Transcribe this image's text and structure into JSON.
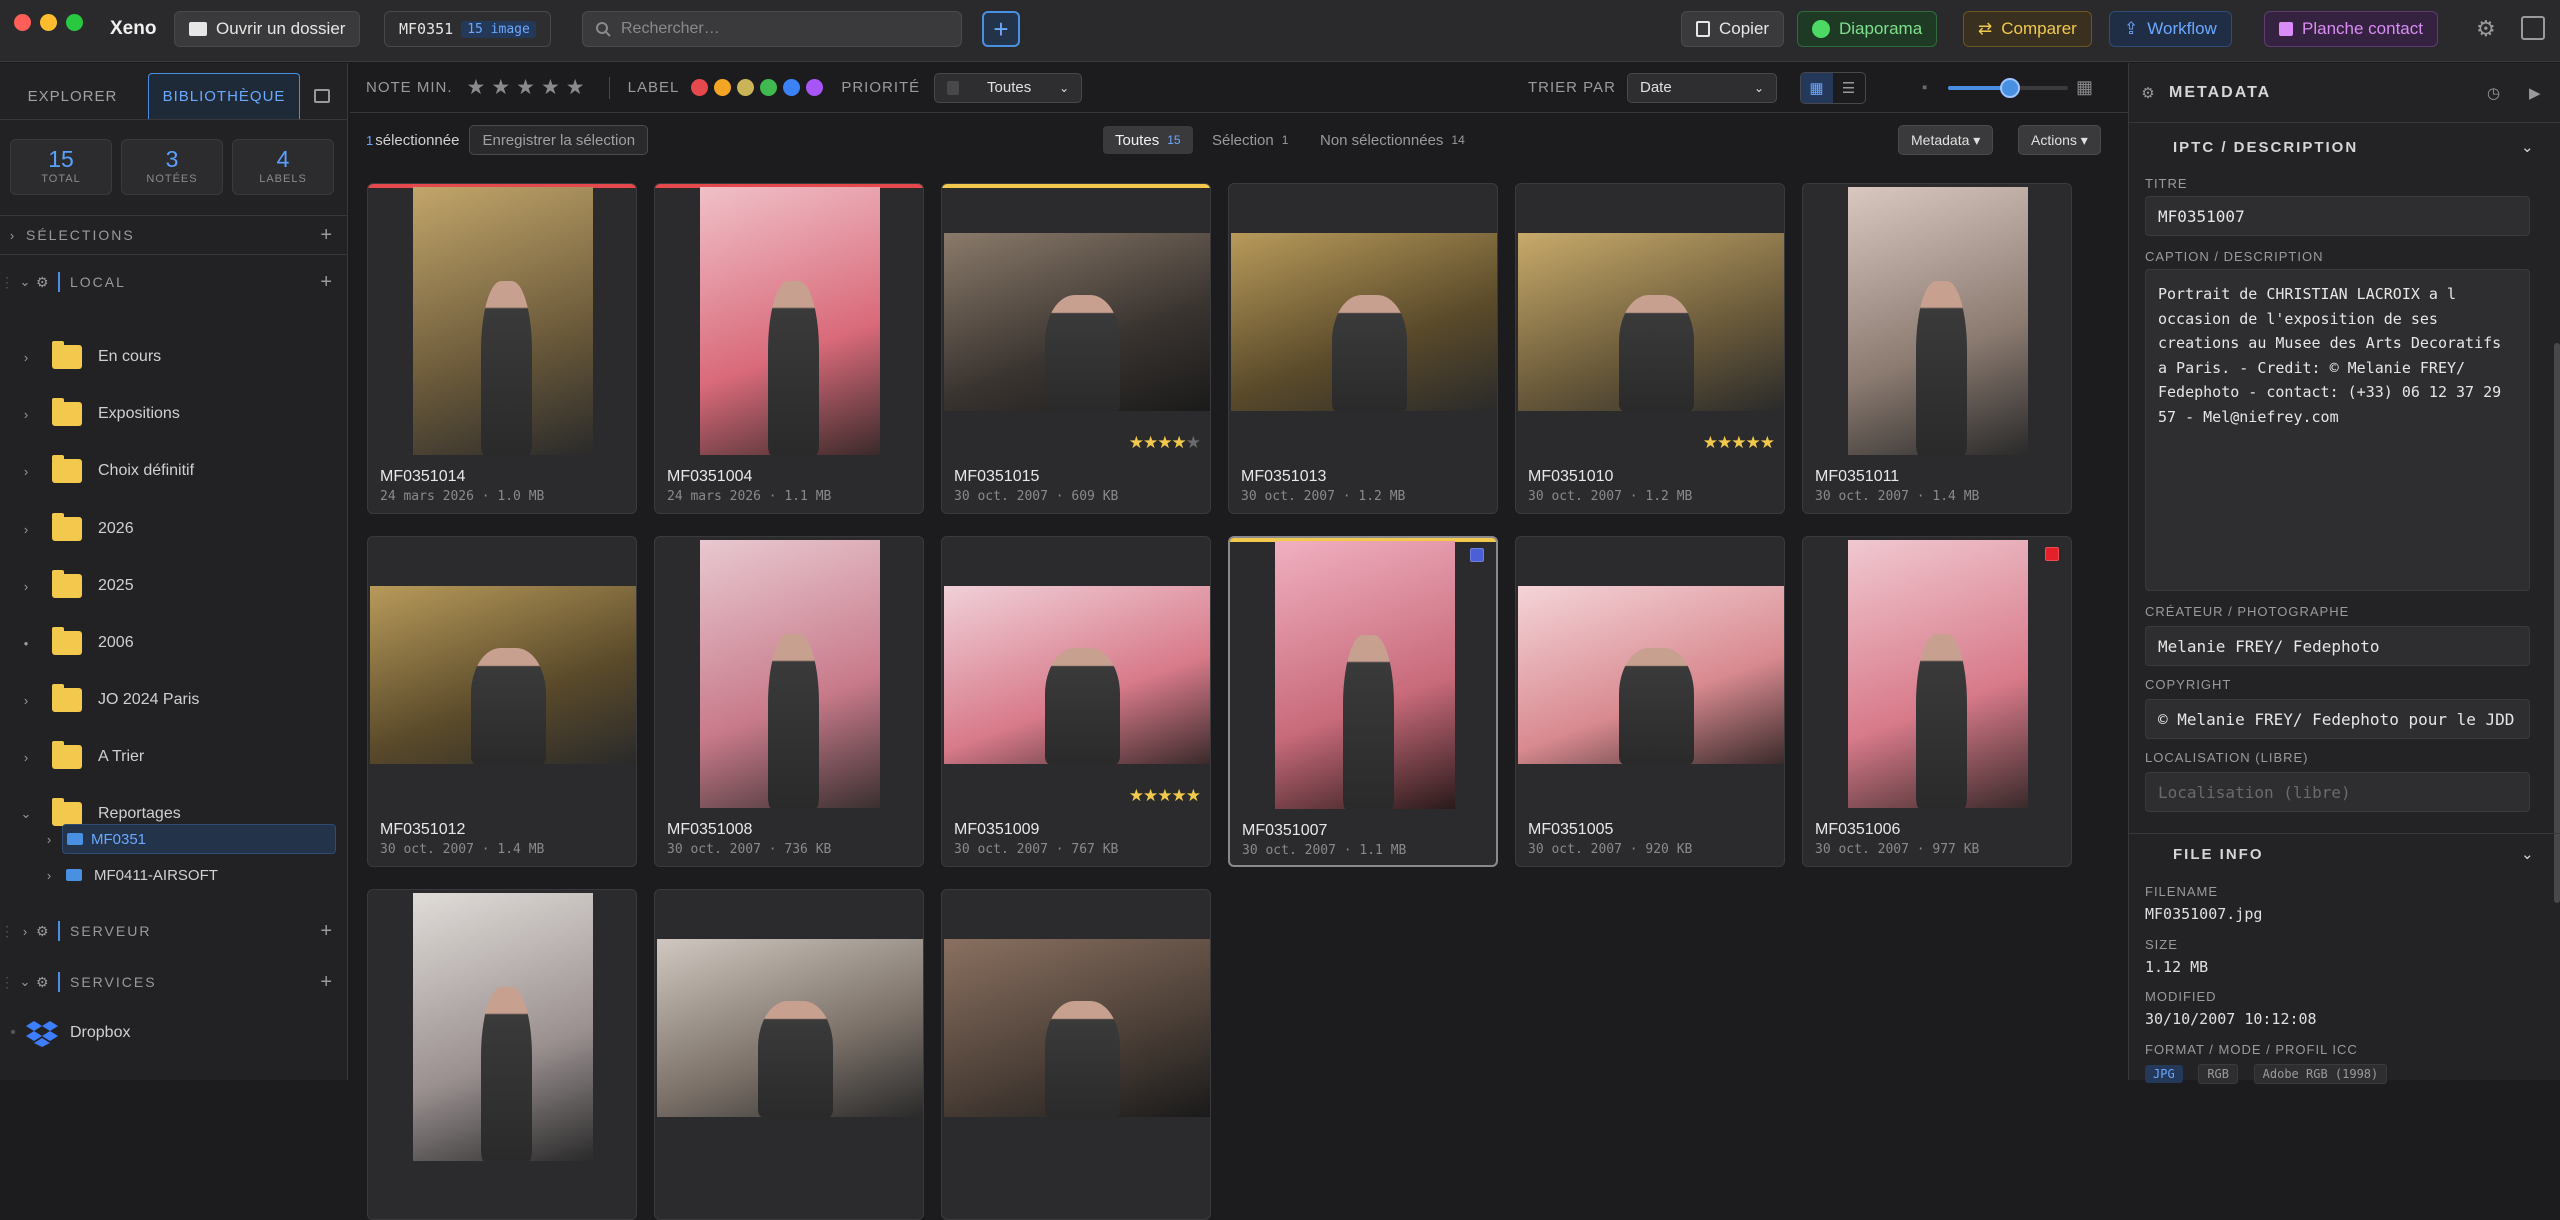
{
  "app": {
    "name": "Xeno"
  },
  "toolbar": {
    "open_folder": "Ouvrir un dossier",
    "folder_code": "MF0351",
    "image_count": "15 image",
    "search_placeholder": "Rechercher…",
    "copy": "Copier",
    "slideshow": "Diaporama",
    "compare": "Comparer",
    "workflow": "Workflow",
    "contact_sheet": "Planche contact"
  },
  "sidebar": {
    "tab_explorer": "EXPLORER",
    "tab_library": "BIBLIOTHÈQUE",
    "stats": [
      {
        "value": "15",
        "label": "TOTAL"
      },
      {
        "value": "3",
        "label": "NOTÉES"
      },
      {
        "value": "4",
        "label": "LABELS"
      }
    ],
    "selections": "SÉLECTIONS",
    "local": "LOCAL",
    "folders": [
      {
        "label": "En cours"
      },
      {
        "label": "Expositions"
      },
      {
        "label": "Choix définitif"
      },
      {
        "label": "2026"
      },
      {
        "label": "2025"
      },
      {
        "label": "2006"
      },
      {
        "label": "JO 2024 Paris"
      },
      {
        "label": "A Trier"
      },
      {
        "label": "Reportages"
      }
    ],
    "subfolders": [
      {
        "label": "MF0351"
      },
      {
        "label": "MF0411-AIRSOFT"
      }
    ],
    "server": "SERVEUR",
    "services": "SERVICES",
    "dropbox": "Dropbox"
  },
  "filters": {
    "min_rating": "NOTE MIN.",
    "label": "LABEL",
    "label_colors": [
      "#e5484d",
      "#f5a524",
      "#c9b458",
      "#3fb950",
      "#3b82f6",
      "#a855f7"
    ],
    "priority": "PRIORITÉ",
    "priority_value": "Toutes",
    "sort_by": "TRIER PAR",
    "sort_value": "Date"
  },
  "selection": {
    "count": "1",
    "selected_label": "sélectionnée",
    "save": "Enregistrer la sélection",
    "all": "Toutes",
    "all_count": "15",
    "sel": "Sélection",
    "sel_count": "1",
    "unsel": "Non sélectionnées",
    "unsel_count": "14",
    "metadata_btn": "Metadata ▾",
    "actions_btn": "Actions ▾"
  },
  "photos": [
    {
      "name": "MF0351014",
      "date": "24 mars 2026",
      "size": "1.0 MB",
      "stars": 0,
      "flag": "",
      "top": "#e5484d"
    },
    {
      "name": "MF0351004",
      "date": "24 mars 2026",
      "size": "1.1 MB",
      "stars": 0,
      "flag": "",
      "top": "#e5484d"
    },
    {
      "name": "MF0351015",
      "date": "30 oct. 2007",
      "size": "609 KB",
      "stars": 4,
      "flag": "",
      "top": "#f2c94c"
    },
    {
      "name": "MF0351013",
      "date": "30 oct. 2007",
      "size": "1.2 MB",
      "stars": 0,
      "flag": "",
      "top": ""
    },
    {
      "name": "MF0351010",
      "date": "30 oct. 2007",
      "size": "1.2 MB",
      "stars": 5,
      "flag": "",
      "top": ""
    },
    {
      "name": "MF0351011",
      "date": "30 oct. 2007",
      "size": "1.4 MB",
      "stars": 0,
      "flag": "",
      "top": ""
    },
    {
      "name": "MF0351012",
      "date": "30 oct. 2007",
      "size": "1.4 MB",
      "stars": 0,
      "flag": "",
      "top": ""
    },
    {
      "name": "MF0351008",
      "date": "30 oct. 2007",
      "size": "736 KB",
      "stars": 0,
      "flag": "",
      "top": ""
    },
    {
      "name": "MF0351009",
      "date": "30 oct. 2007",
      "size": "767 KB",
      "stars": 5,
      "flag": "",
      "top": ""
    },
    {
      "name": "MF0351007",
      "date": "30 oct. 2007",
      "size": "1.1 MB",
      "stars": 0,
      "flag": "#4b5fd6",
      "top": "#f2c94c"
    },
    {
      "name": "MF0351005",
      "date": "30 oct. 2007",
      "size": "920 KB",
      "stars": 0,
      "flag": "",
      "top": ""
    },
    {
      "name": "MF0351006",
      "date": "30 oct. 2007",
      "size": "977 KB",
      "stars": 0,
      "flag": "#e5202a",
      "top": ""
    },
    {
      "name": "",
      "date": "",
      "size": "",
      "stars": 0,
      "flag": "",
      "top": ""
    },
    {
      "name": "",
      "date": "",
      "size": "",
      "stars": 0,
      "flag": "",
      "top": ""
    },
    {
      "name": "",
      "date": "",
      "size": "",
      "stars": 0,
      "flag": "",
      "top": ""
    }
  ],
  "panel": {
    "title": "METADATA",
    "iptc": "IPTC / DESCRIPTION",
    "title_label": "TITRE",
    "title_value": "MF0351007",
    "caption_label": "CAPTION / DESCRIPTION",
    "caption_value": "Portrait de CHRISTIAN LACROIX a l occasion de l'exposition de ses creations au Musee des Arts Decoratifs a Paris. - Credit: © Melanie FREY/ Fedephoto - contact: (+33) 06 12 37 29 57 - Mel@niefrey.com",
    "creator_label": "CRÉATEUR / PHOTOGRAPHE",
    "creator_value": "Melanie FREY/ Fedephoto",
    "copyright_label": "COPYRIGHT",
    "copyright_value": "© Melanie FREY/ Fedephoto pour le JDD",
    "location_label": "LOCALISATION (LIBRE)",
    "location_placeholder": "Localisation (libre)",
    "file_info": "FILE INFO",
    "filename_label": "FILENAME",
    "filename_value": "MF0351007.jpg",
    "size_label": "SIZE",
    "size_value": "1.12 MB",
    "modified_label": "MODIFIED",
    "modified_value": "30/10/2007 10:12:08",
    "format_label": "FORMAT / MODE / PROFIL ICC",
    "format_tags": [
      "JPG",
      "RGB",
      "Adobe RGB (1998)"
    ]
  }
}
